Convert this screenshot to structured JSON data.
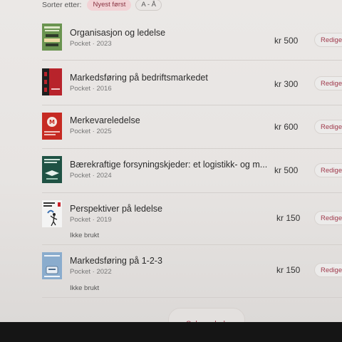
{
  "sort": {
    "label": "Sorter etter:",
    "options": [
      {
        "label": "Nyest først",
        "active": true
      },
      {
        "label": "A - Å",
        "active": false
      }
    ]
  },
  "books": [
    {
      "title": "Organisasjon og ledelse",
      "format": "Pocket",
      "year": "2023",
      "meta": "Pocket · 2023",
      "price": "kr 500",
      "edit_label": "Rediger",
      "condition": "",
      "cover_color": "#5e8a4c"
    },
    {
      "title": "Markedsføring på bedriftsmarkedet",
      "format": "Pocket",
      "year": "2016",
      "meta": "Pocket · 2016",
      "price": "kr 300",
      "edit_label": "Rediger",
      "condition": "",
      "cover_color": "#b8232b"
    },
    {
      "title": "Merkevareledelse",
      "format": "Pocket",
      "year": "2025",
      "meta": "Pocket · 2025",
      "price": "kr 600",
      "edit_label": "Rediger",
      "condition": "",
      "cover_color": "#c62a22"
    },
    {
      "title": "Bærekraftige forsyningskjeder: et logistikk- og m...",
      "format": "Pocket",
      "year": "2024",
      "meta": "Pocket · 2024",
      "price": "kr 500",
      "edit_label": "Rediger",
      "condition": "",
      "cover_color": "#1f5244"
    },
    {
      "title": "Perspektiver på ledelse",
      "format": "Pocket",
      "year": "2019",
      "meta": "Pocket · 2019",
      "price": "kr 150",
      "edit_label": "Rediger",
      "condition": "Ikke brukt",
      "cover_color": "#f4f4f4"
    },
    {
      "title": "Markedsføring på 1-2-3",
      "format": "Pocket",
      "year": "2022",
      "meta": "Pocket · 2022",
      "price": "kr 150",
      "edit_label": "Rediger",
      "condition": "Ikke brukt",
      "cover_color": "#8aaccd"
    }
  ],
  "sell_button": "Selg en bok"
}
